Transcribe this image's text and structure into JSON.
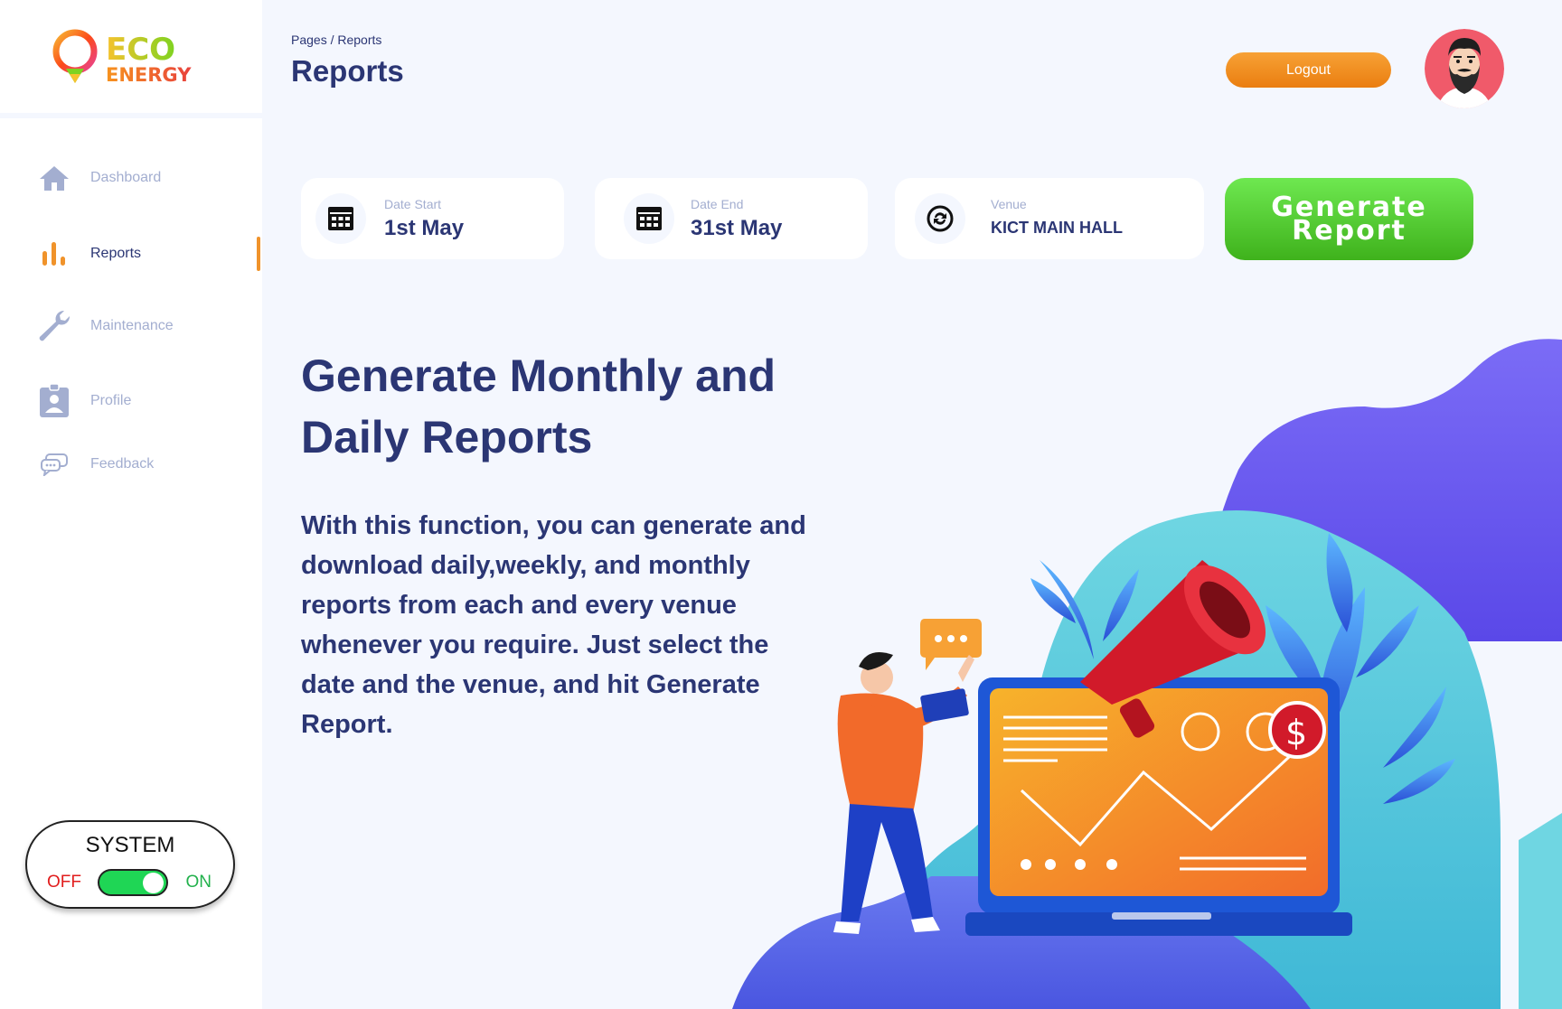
{
  "brand": {
    "line1": "ECO",
    "line2": "ENERGY"
  },
  "sidebar": {
    "items": [
      {
        "label": "Dashboard",
        "icon": "home-icon",
        "active": false
      },
      {
        "label": "Reports",
        "icon": "bar-chart-icon",
        "active": true
      },
      {
        "label": "Maintenance",
        "icon": "wrench-icon",
        "active": false
      },
      {
        "label": "Profile",
        "icon": "badge-icon",
        "active": false
      },
      {
        "label": "Feedback",
        "icon": "chat-icon",
        "active": false
      }
    ]
  },
  "system_toggle": {
    "title": "SYSTEM",
    "off_label": "OFF",
    "on_label": "ON",
    "state": "on"
  },
  "header": {
    "breadcrumb": "Pages / Reports",
    "title": "Reports",
    "logout_label": "Logout"
  },
  "filters": {
    "date_start": {
      "label": "Date Start",
      "value": "1st May"
    },
    "date_end": {
      "label": "Date End",
      "value": "31st May"
    },
    "venue": {
      "label": "Venue",
      "value": "KICT MAIN HALL"
    }
  },
  "generate_button": {
    "line1": "Generate",
    "line2": "Report"
  },
  "hero": {
    "title": "Generate Monthly and Daily Reports",
    "description": "With this function, you can generate and download daily,weekly, and monthly reports from each and every venue whenever you require. Just select the date and the venue, and hit Generate Report."
  },
  "colors": {
    "accent": "#f0932b",
    "primary_text": "#2b3674",
    "muted_text": "#a3aed0",
    "generate_green": "#4cc82a",
    "toggle_on": "#1fd655"
  }
}
